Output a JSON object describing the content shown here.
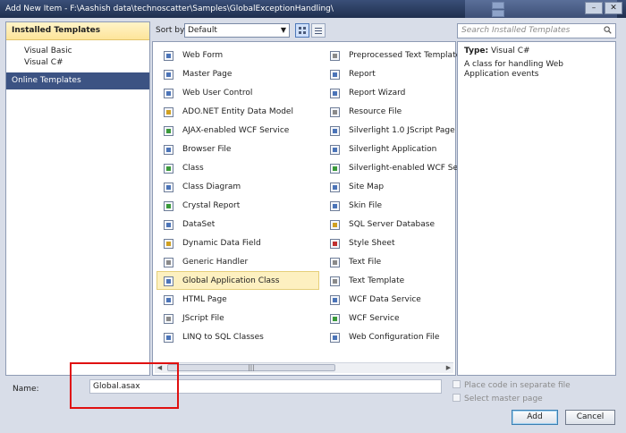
{
  "window": {
    "title": "Add New Item - F:\\Aashish data\\technoscatter\\Samples\\GlobalExceptionHandling\\",
    "min_glyph": "–",
    "close_glyph": "✕"
  },
  "left_pane": {
    "installed_header": "Installed Templates",
    "tree_items": [
      "Visual Basic",
      "Visual C#"
    ],
    "online_header": "Online Templates"
  },
  "toolbar": {
    "sort_label": "Sort by:",
    "sort_value": "Default",
    "search_placeholder": "Search Installed Templates"
  },
  "templates": {
    "column1": [
      {
        "label": "Web Form",
        "icon": "web-form-icon",
        "color": "#4b74b8"
      },
      {
        "label": "Master Page",
        "icon": "master-page-icon",
        "color": "#4b74b8"
      },
      {
        "label": "Web User Control",
        "icon": "web-user-control-icon",
        "color": "#4b74b8"
      },
      {
        "label": "ADO.NET Entity Data Model",
        "icon": "entity-model-icon",
        "color": "#d0a020"
      },
      {
        "label": "AJAX-enabled WCF Service",
        "icon": "wcf-service-icon",
        "color": "#3a9a3a"
      },
      {
        "label": "Browser File",
        "icon": "browser-file-icon",
        "color": "#4b74b8"
      },
      {
        "label": "Class",
        "icon": "class-icon",
        "color": "#3a9a3a"
      },
      {
        "label": "Class Diagram",
        "icon": "class-diagram-icon",
        "color": "#4b74b8"
      },
      {
        "label": "Crystal Report",
        "icon": "crystal-report-icon",
        "color": "#3a9a3a"
      },
      {
        "label": "DataSet",
        "icon": "dataset-icon",
        "color": "#4b74b8"
      },
      {
        "label": "Dynamic Data Field",
        "icon": "dynamic-data-icon",
        "color": "#d0a020"
      },
      {
        "label": "Generic Handler",
        "icon": "generic-handler-icon",
        "color": "#8a8a8a"
      },
      {
        "label": "Global Application Class",
        "icon": "global-app-class-icon",
        "color": "#4b74b8"
      },
      {
        "label": "HTML Page",
        "icon": "html-page-icon",
        "color": "#4b74b8"
      },
      {
        "label": "JScript File",
        "icon": "jscript-file-icon",
        "color": "#8a8a8a"
      },
      {
        "label": "LINQ to SQL Classes",
        "icon": "linq-icon",
        "color": "#4b74b8"
      }
    ],
    "column2": [
      {
        "label": "Preprocessed Text Template",
        "icon": "text-template-icon",
        "color": "#8a8a8a"
      },
      {
        "label": "Report",
        "icon": "report-icon",
        "color": "#4b74b8"
      },
      {
        "label": "Report Wizard",
        "icon": "report-wizard-icon",
        "color": "#4b74b8"
      },
      {
        "label": "Resource File",
        "icon": "resource-file-icon",
        "color": "#8a8a8a"
      },
      {
        "label": "Silverlight 1.0 JScript Page",
        "icon": "silverlight-page-icon",
        "color": "#4b74b8"
      },
      {
        "label": "Silverlight Application",
        "icon": "silverlight-app-icon",
        "color": "#4b74b8"
      },
      {
        "label": "Silverlight-enabled WCF Service",
        "icon": "silverlight-wcf-icon",
        "color": "#3a9a3a"
      },
      {
        "label": "Site Map",
        "icon": "site-map-icon",
        "color": "#4b74b8"
      },
      {
        "label": "Skin File",
        "icon": "skin-file-icon",
        "color": "#4b74b8"
      },
      {
        "label": "SQL Server Database",
        "icon": "sql-database-icon",
        "color": "#d0a020"
      },
      {
        "label": "Style Sheet",
        "icon": "style-sheet-icon",
        "color": "#c03030"
      },
      {
        "label": "Text File",
        "icon": "text-file-icon",
        "color": "#8a8a8a"
      },
      {
        "label": "Text Template",
        "icon": "text-template-icon",
        "color": "#8a8a8a"
      },
      {
        "label": "WCF Data Service",
        "icon": "wcf-data-service-icon",
        "color": "#4b74b8"
      },
      {
        "label": "WCF Service",
        "icon": "wcf-service-icon",
        "color": "#3a9a3a"
      },
      {
        "label": "Web Configuration File",
        "icon": "web-config-icon",
        "color": "#4b74b8"
      }
    ],
    "selected": "Global Application Class"
  },
  "details": {
    "type_label": "Type:",
    "type_value": "Visual C#",
    "description": "A class for handling Web Application events"
  },
  "bottom": {
    "name_label": "Name:",
    "name_value": "Global.asax",
    "place_code_label": "Place code in separate file",
    "select_master_label": "Select master page",
    "add_label": "Add",
    "cancel_label": "Cancel"
  },
  "colors": {
    "selection_bg": "#fdf0c0",
    "online_header_bg": "#3c5383",
    "annotation_red": "#e01010"
  }
}
